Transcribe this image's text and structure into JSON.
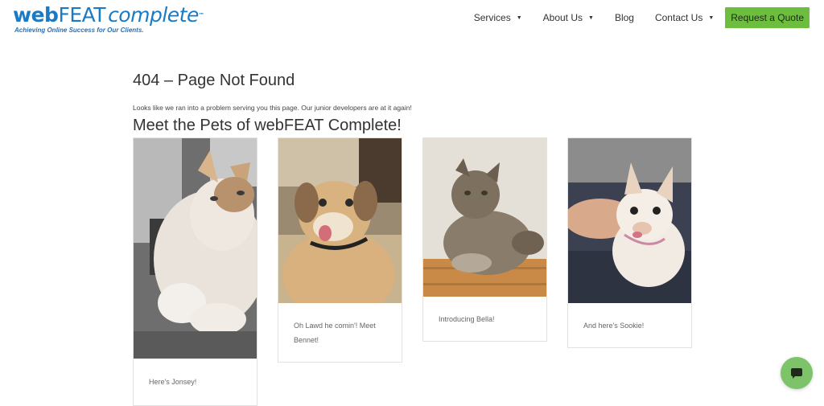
{
  "logo": {
    "web": "web",
    "feat": "FEAT",
    "complete": "complete",
    "tm": "™",
    "tagline": "Achieving Online Success for Our Clients."
  },
  "nav": {
    "services": "Services",
    "about": "About Us",
    "blog": "Blog",
    "contact": "Contact Us",
    "quote": "Request a Quote"
  },
  "main": {
    "title": "404 – Page Not Found",
    "intro": "Looks like we ran into a problem serving you this page. Our junior developers are at it again!",
    "pets_title": "Meet the Pets of webFEAT Complete!"
  },
  "pets": [
    {
      "caption": "Here's Jonsey!"
    },
    {
      "caption": "Oh Lawd he comin'! Meet Bennet!"
    },
    {
      "caption": "Introducing Bella!"
    },
    {
      "caption": "And here's Sookie!"
    }
  ],
  "colors": {
    "brand_blue": "#1b7ac4",
    "quote_green": "#6dbd3f",
    "chat_green": "#7cc36a"
  }
}
